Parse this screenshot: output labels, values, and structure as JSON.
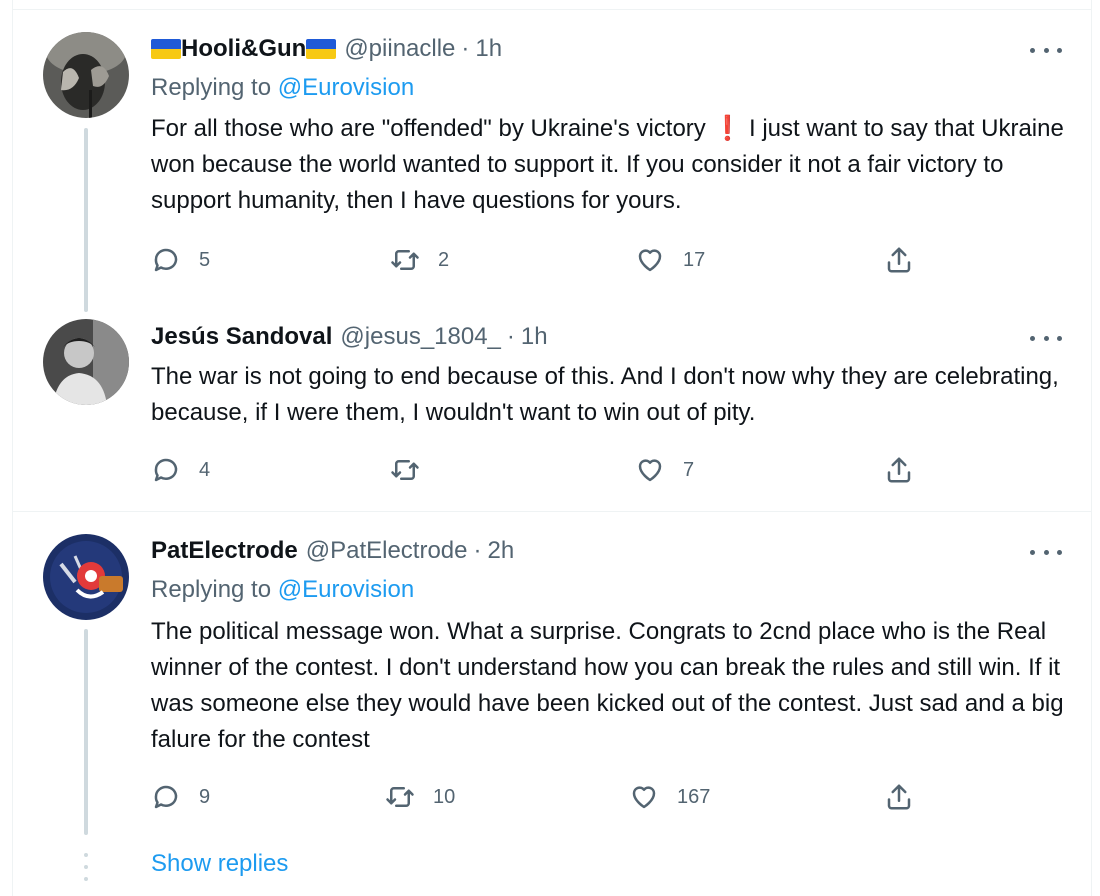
{
  "tweets": [
    {
      "display_name": "Hooli&Gun",
      "handle": "@piinaclle",
      "separator": "·",
      "time": "1h",
      "replying_prefix": "Replying to",
      "replying_to": "@Eurovision",
      "text_a": "For all those who are \"offended\" by Ukraine's victory",
      "text_excl": "❗",
      "text_b": " I just want to say that Ukraine won because the world wanted to support it. If you consider it not a fair victory to support humanity, then I have questions for yours.",
      "replies": "5",
      "retweets": "2",
      "likes": "17",
      "flag_colors": [
        "#1f5ad7",
        "#f7c913"
      ]
    },
    {
      "display_name": "Jesús Sandoval",
      "handle": "@jesus_1804_",
      "separator": "·",
      "time": "1h",
      "text": "The war is not going to end because of this. And I don't now why they are celebrating, because, if I were them, I wouldn't want to win out of pity.",
      "replies": "4",
      "retweets": "",
      "likes": "7"
    },
    {
      "display_name": "PatElectrode",
      "handle": "@PatElectrode",
      "separator": "·",
      "time": "2h",
      "replying_prefix": "Replying to",
      "replying_to": "@Eurovision",
      "text": "The political message won. What a surprise. Congrats to 2cnd place who is the Real winner of the contest. I don't understand how you can break the rules and still win. If it was someone else they would have been kicked out of the contest. Just sad and a big falure for the contest",
      "replies": "9",
      "retweets": "10",
      "likes": "167"
    }
  ],
  "show_replies": "Show replies",
  "colors": {
    "link": "#1d9bf0",
    "secondary_text": "#536471",
    "primary_text": "#0f1419",
    "thread_line": "#cfd9de"
  }
}
